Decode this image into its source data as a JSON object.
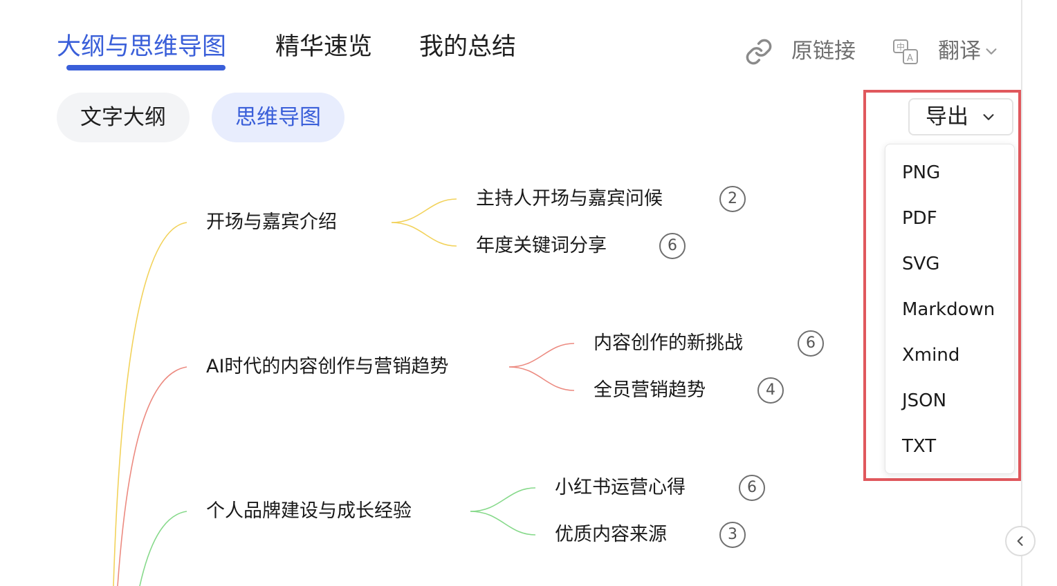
{
  "tabs": [
    {
      "label": "大纲与思维导图",
      "active": true
    },
    {
      "label": "精华速览",
      "active": false
    },
    {
      "label": "我的总结",
      "active": false
    }
  ],
  "actions": {
    "original_link": {
      "label": "原链接",
      "icon": "link-icon"
    },
    "translate": {
      "label": "翻译",
      "icon": "translate-icon"
    }
  },
  "view_toggle": {
    "outline": "文字大纲",
    "mindmap": "思维导图",
    "active": "mindmap"
  },
  "export": {
    "label": "导出",
    "options": [
      "PNG",
      "PDF",
      "SVG",
      "Markdown",
      "Xmind",
      "JSON",
      "TXT"
    ]
  },
  "mindmap": {
    "branches": [
      {
        "title": "开场与嘉宾介绍",
        "color": "#f2d25a",
        "children": [
          {
            "title": "主持人开场与嘉宾问候",
            "count": "2"
          },
          {
            "title": "年度关键词分享",
            "count": "6"
          }
        ]
      },
      {
        "title": "AI时代的内容创作与营销趋势",
        "color": "#ec8a80",
        "children": [
          {
            "title": "内容创作的新挑战",
            "count": "6"
          },
          {
            "title": "全员营销趋势",
            "count": "4"
          }
        ]
      },
      {
        "title": "个人品牌建设与成长经验",
        "color": "#86d98a",
        "children": [
          {
            "title": "小红书运营心得",
            "count": "6"
          },
          {
            "title": "优质内容来源",
            "count": "3"
          }
        ]
      }
    ]
  },
  "colors": {
    "accent": "#3a5fd9",
    "highlight_border": "#e0585d"
  }
}
